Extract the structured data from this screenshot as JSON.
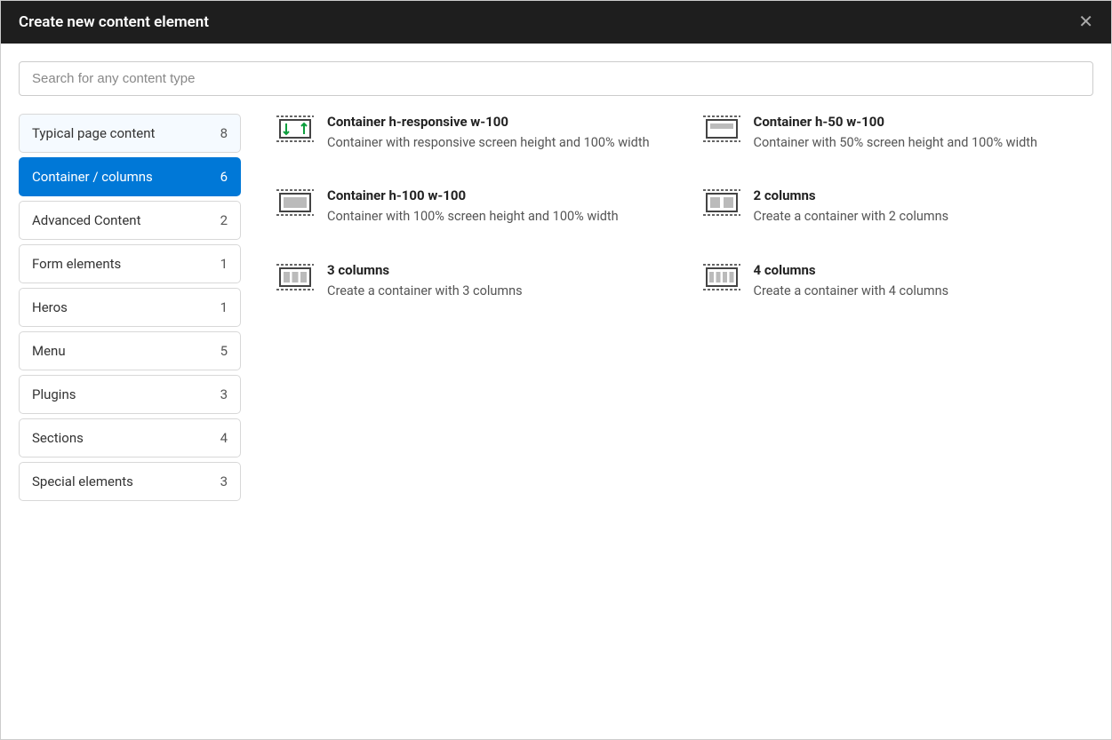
{
  "header": {
    "title": "Create new content element"
  },
  "search": {
    "placeholder": "Search for any content type"
  },
  "sidebar": {
    "items": [
      {
        "label": "Typical page content",
        "count": "8"
      },
      {
        "label": "Container / columns",
        "count": "6"
      },
      {
        "label": "Advanced Content",
        "count": "2"
      },
      {
        "label": "Form elements",
        "count": "1"
      },
      {
        "label": "Heros",
        "count": "1"
      },
      {
        "label": "Menu",
        "count": "5"
      },
      {
        "label": "Plugins",
        "count": "3"
      },
      {
        "label": "Sections",
        "count": "4"
      },
      {
        "label": "Special elements",
        "count": "3"
      }
    ],
    "activeIndex": 1
  },
  "items": [
    {
      "title": "Container h-responsive w-100",
      "desc": "Container with responsive screen height and 100% width",
      "icon": "responsive"
    },
    {
      "title": "Container h-50 w-100",
      "desc": "Container with 50% screen height and 100% width",
      "icon": "half"
    },
    {
      "title": "Container h-100 w-100",
      "desc": "Container with 100% screen height and 100% width",
      "icon": "full"
    },
    {
      "title": "2 columns",
      "desc": "Create a container with 2 columns",
      "icon": "col2"
    },
    {
      "title": "3 columns",
      "desc": "Create a container with 3 columns",
      "icon": "col3"
    },
    {
      "title": "4 columns",
      "desc": "Create a container with 4 columns",
      "icon": "col4"
    }
  ]
}
